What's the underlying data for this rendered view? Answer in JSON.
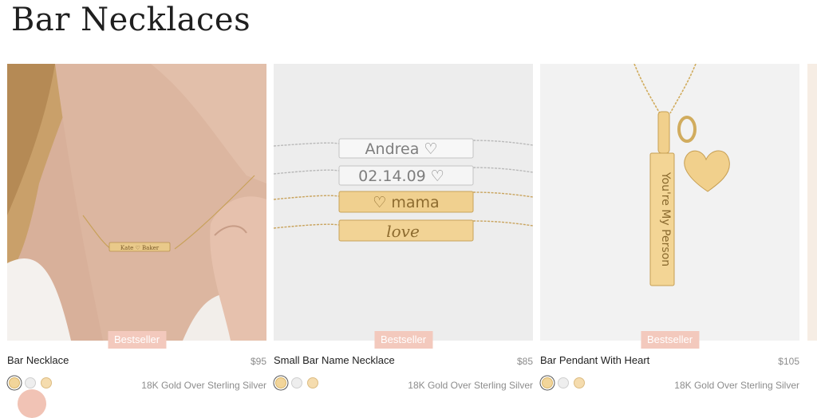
{
  "page": {
    "title": "Bar Necklaces"
  },
  "products": [
    {
      "name": "Bar Necklace",
      "price": "$95",
      "badge": "Bestseller",
      "material": "18K Gold Over Sterling Silver",
      "engraving": "Kate ♡ Baker"
    },
    {
      "name": "Small Bar Name Necklace",
      "price": "$85",
      "badge": "Bestseller",
      "material": "18K Gold Over Sterling Silver",
      "engravings": [
        "Andrea ♡",
        "02.14.09 ♡",
        "♡ mama",
        "love"
      ]
    },
    {
      "name": "Bar Pendant With Heart",
      "price": "$105",
      "badge": "Bestseller",
      "material": "18K Gold Over Sterling Silver",
      "engraving": "You're My Person"
    }
  ],
  "swatch_colors": {
    "gold": "#f2d59a",
    "silver": "#eeeeee",
    "rose_gold": "#f5dcae"
  },
  "colors": {
    "badge_bg": "#f3c9bd",
    "text": "#1f1f1f",
    "muted": "#8c8c8c"
  }
}
